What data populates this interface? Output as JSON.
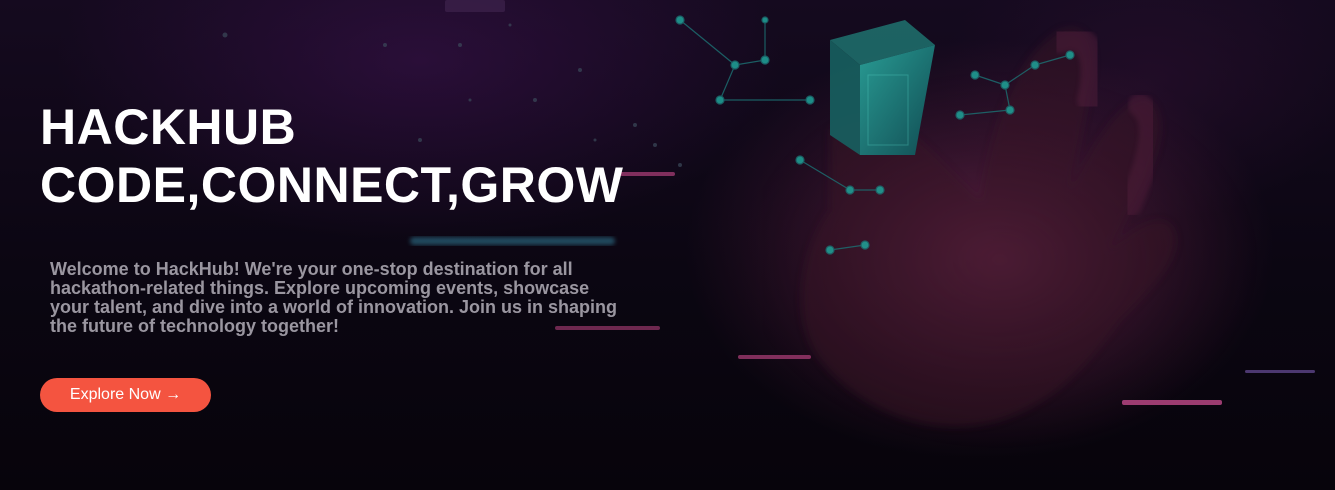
{
  "hero": {
    "title_line1": "HACKHUB",
    "title_line2": "CODE,CONNECT,GROW",
    "description": "Welcome to HackHub! We're your one-stop destination for all hackathon-related things. Explore upcoming events, showcase your talent, and dive into a world of innovation. Join us in shaping the future of technology together!",
    "cta_label": "Explore Now →"
  },
  "theme": {
    "background": "#0a0610",
    "accent": "#f45440",
    "title_color": "#ffffff",
    "text_color": "#9a96a0",
    "node_color": "#1fa59a",
    "streak_pink": "#b0407a",
    "streak_cyan": "#3a9ab8"
  },
  "background_art": {
    "icons": [
      "hand-icon",
      "cube-icon",
      "network-icon"
    ]
  }
}
